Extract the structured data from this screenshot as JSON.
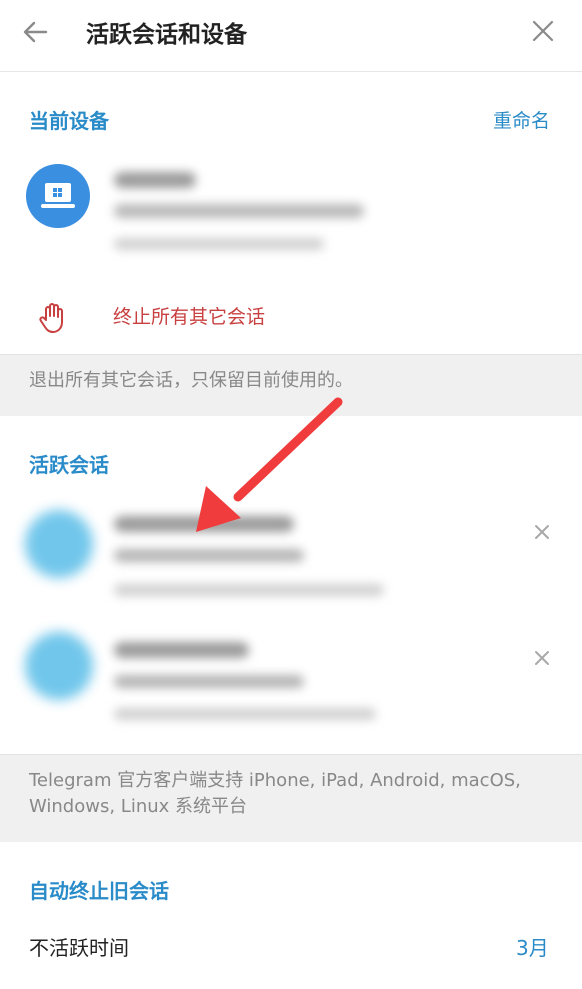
{
  "header": {
    "title": "活跃会话和设备"
  },
  "current_device": {
    "section_title": "当前设备",
    "rename_label": "重命名",
    "terminate_label": "终止所有其它会话",
    "hint": "退出所有其它会话，只保留目前使用的。"
  },
  "active_sessions": {
    "section_title": "活跃会话",
    "hint_line1": "Telegram 官方客户端支持 iPhone, iPad, Android, macOS,",
    "hint_line2": "Windows, Linux 系统平台"
  },
  "auto_terminate": {
    "section_title": "自动终止旧会话",
    "inactive_label": "不活跃时间",
    "inactive_value": "3月"
  },
  "colors": {
    "accent": "#2a8bc9",
    "danger": "#c94040",
    "annotation_arrow": "#f03c3c"
  }
}
